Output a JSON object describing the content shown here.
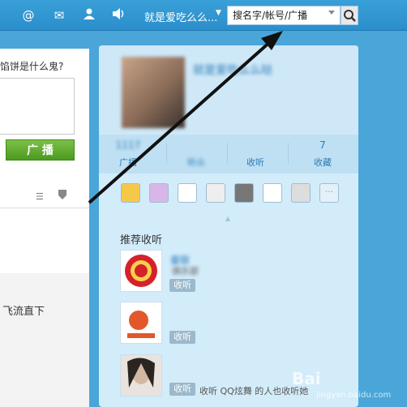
{
  "topbar": {
    "icons": [
      "at-icon",
      "mail-icon",
      "user-icon",
      "speaker-icon"
    ],
    "user_name": "就是爱吃么么...",
    "search_placeholder": "搜名字/帐号/广播"
  },
  "left": {
    "question": "馅饼是什么鬼?",
    "broadcast_label": "广 播",
    "feed_text": "飞流直下"
  },
  "profile": {
    "name": "就是爱吃么么哒",
    "stats": [
      {
        "value": "1117",
        "label": "广播"
      },
      {
        "value": "",
        "label": "听众"
      },
      {
        "value": "",
        "label": "收听"
      },
      {
        "value": "7",
        "label": "收藏"
      }
    ]
  },
  "apps": [
    "smile-icon",
    "face-icon",
    "circle-arrow-icon",
    "robot-icon",
    "music-icon",
    "blank-icon",
    "star-icon",
    "more-icon"
  ],
  "recommend": {
    "title": "推荐收听",
    "items": [
      {
        "name": "曼联",
        "desc": "俱乐部",
        "btn": "收听"
      },
      {
        "name": "",
        "desc": "",
        "btn": "收听"
      },
      {
        "name": "",
        "desc": "收听 QQ炫舞 的人也收听她",
        "btn": "收听"
      }
    ]
  },
  "watermark": {
    "brand": "Bai",
    "sub": "jingyan.baidu.com"
  }
}
